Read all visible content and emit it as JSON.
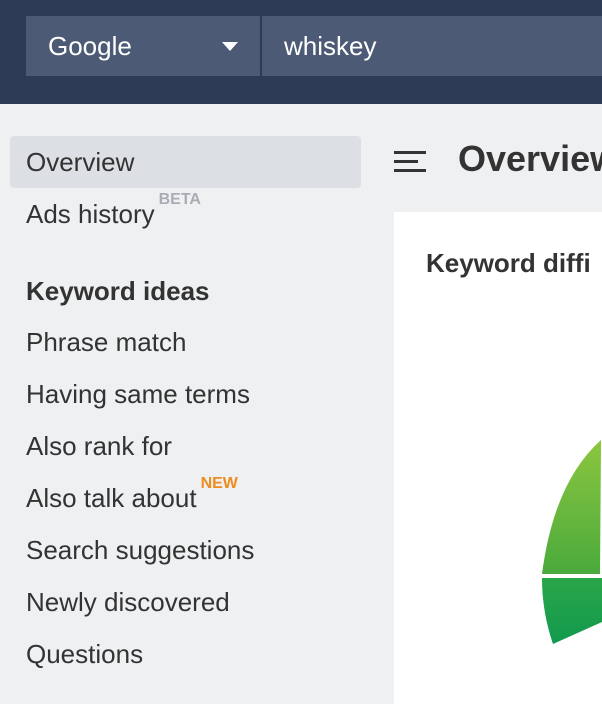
{
  "search": {
    "engine": "Google",
    "query": "whiskey"
  },
  "sidebar": {
    "items": [
      {
        "label": "Overview",
        "active": true
      },
      {
        "label": "Ads history",
        "badge": "BETA"
      }
    ],
    "section_heading": "Keyword ideas",
    "idea_items": [
      {
        "label": "Phrase match"
      },
      {
        "label": "Having same terms"
      },
      {
        "label": "Also rank for"
      },
      {
        "label": "Also talk about",
        "badge": "NEW"
      },
      {
        "label": "Search suggestions"
      },
      {
        "label": "Newly discovered"
      },
      {
        "label": "Questions"
      }
    ]
  },
  "main": {
    "title": "Overview",
    "card_title": "Keyword diffi"
  },
  "colors": {
    "topbar": "#2e3b57",
    "input_bg": "#4c5a75",
    "badge_new": "#f08c1e",
    "badge_beta": "#a9adb3",
    "gauge_light": "#8cc63f",
    "gauge_dark": "#1a9e4f"
  },
  "icons": [
    "caret-down-icon",
    "hamburger-menu-icon"
  ]
}
